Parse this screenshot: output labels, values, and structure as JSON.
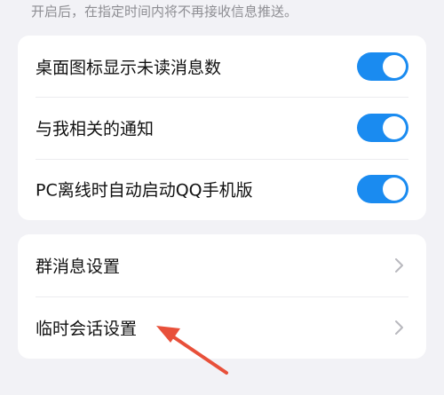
{
  "header": {
    "hint_text": "开启后，在指定时间内将不再接收信息推送。"
  },
  "toggle_section": {
    "items": [
      {
        "label": "桌面图标显示未读消息数",
        "state": "on"
      },
      {
        "label": "与我相关的通知",
        "state": "on"
      },
      {
        "label": "PC离线时自动启动QQ手机版",
        "state": "on"
      }
    ]
  },
  "link_section": {
    "items": [
      {
        "label": "群消息设置"
      },
      {
        "label": "临时会话设置"
      }
    ]
  },
  "colors": {
    "accent": "#1a8bf0",
    "background": "#f2f2f6",
    "card": "#ffffff",
    "annotation_arrow": "#e8503a"
  },
  "icons": {
    "row_link": "chevron-right-icon",
    "annotation": "red-arrow-annotation"
  }
}
